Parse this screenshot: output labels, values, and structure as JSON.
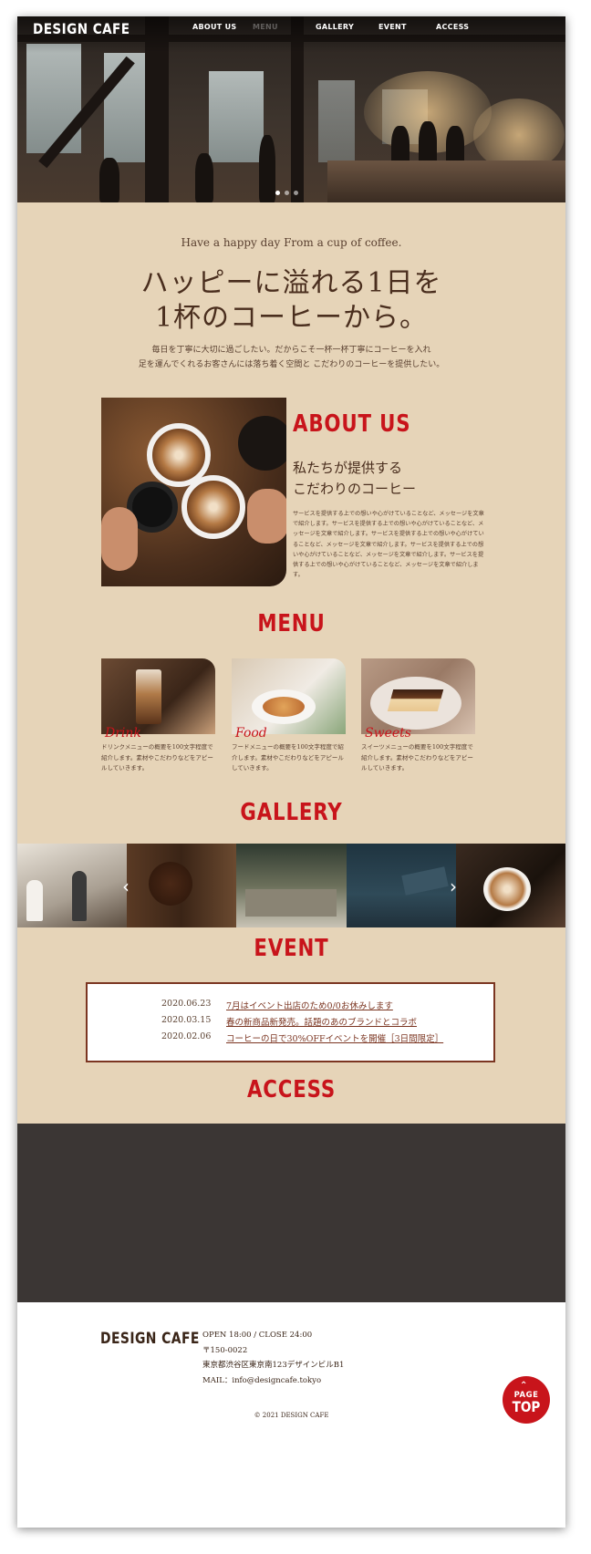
{
  "site": {
    "logo": "DESIGN CAFE"
  },
  "nav": {
    "items": [
      {
        "label": "ABOUT US"
      },
      {
        "label": "MENU"
      },
      {
        "label": "GALLERY"
      },
      {
        "label": "EVENT"
      },
      {
        "label": "ACCESS"
      }
    ]
  },
  "hero": {
    "slide_count": 3,
    "active_slide": 1
  },
  "intro": {
    "tagline": "Have a happy day From a cup of coffee.",
    "headline_line1": "ハッピーに溢れる1日を",
    "headline_line2": "1杯のコーヒーから。",
    "body_line1": "毎日を丁寧に大切に過ごしたい。だからこそ一杯一杯丁寧にコーヒーを入れ",
    "body_line2": "足を運んでくれるお客さんには落ち着く空間と こだわりのコーヒーを提供したい。"
  },
  "about": {
    "title": "ABOUT US",
    "subtitle_line1": "私たちが提供する",
    "subtitle_line2": "こだわりのコーヒー",
    "body": "サービスを提供する上での想いや心がけていることなど、メッセージを文章で紹介します。サービスを提供する上での想いや心がけていることなど、メッセージを文章で紹介します。サービスを提供する上での想いや心がけていることなど、メッセージを文章で紹介します。サービスを提供する上での想いや心がけていることなど、メッセージを文章で紹介します。サービスを提供する上での想いや心がけていることなど、メッセージを文章で紹介します。"
  },
  "menu": {
    "title": "MENU",
    "items": [
      {
        "label": "Drink",
        "desc": "ドリンクメニューの概要を100文字程度で紹介します。素材やこだわりなどをアピールしていきます。"
      },
      {
        "label": "Food",
        "desc": "フードメニューの概要を100文字程度で紹介します。素材やこだわりなどをアピールしていきます。"
      },
      {
        "label": "Sweets",
        "desc": "スイーツメニューの概要を100文字程度で紹介します。素材やこだわりなどをアピールしていきます。"
      }
    ]
  },
  "gallery": {
    "title": "GALLERY",
    "prev_icon": "chevron-left-icon",
    "next_icon": "chevron-right-icon"
  },
  "event": {
    "title": "EVENT",
    "items": [
      {
        "date": "2020.06.23",
        "text": "7月はイベント出店のため0/0お休みします"
      },
      {
        "date": "2020.03.15",
        "text": "春の新商品新発売。話題のあのブランドとコラボ"
      },
      {
        "date": "2020.02.06",
        "text": "コーヒーの日で30%OFFイベントを開催［3日間限定］"
      }
    ]
  },
  "access": {
    "title": "ACCESS"
  },
  "footer": {
    "logo": "DESIGN CAFE",
    "hours": "OPEN 18:00 / CLOSE 24:00",
    "zip": "〒150-0022",
    "address": "東京都渋谷区東京南123デザインビルB1",
    "mail": "MAIL：info@designcafe.tokyo",
    "copyright": "© 2021 DESIGN CAFE"
  },
  "pagetop": {
    "line1": "PAGE",
    "line2": "TOP"
  },
  "colors": {
    "accent": "#c8141b",
    "background": "#e6d4b8",
    "text": "#4a2e1e",
    "map": "#3b3634"
  }
}
